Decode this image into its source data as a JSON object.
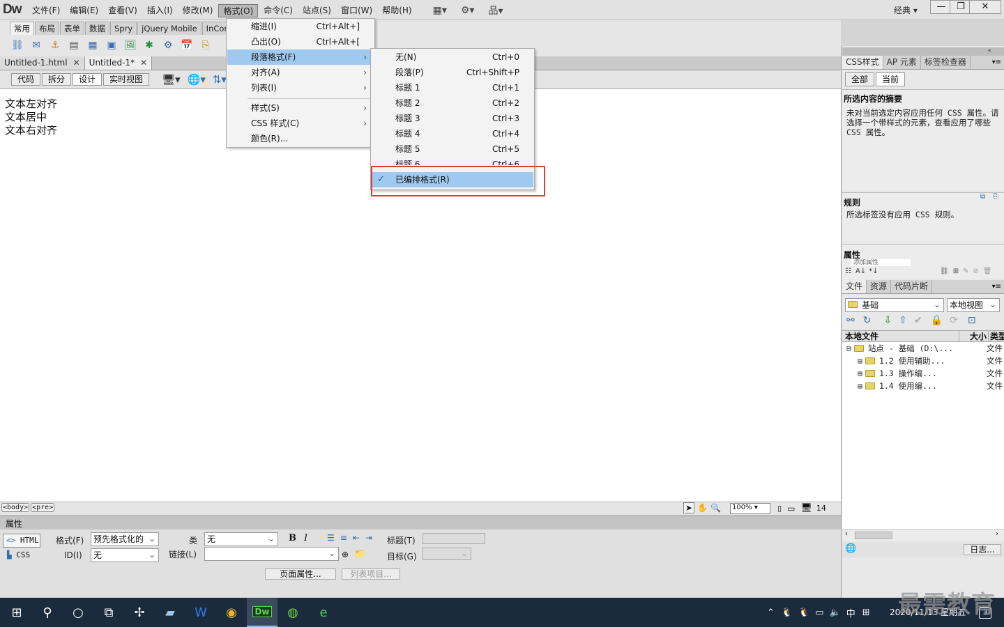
{
  "app": {
    "logo": "Dw",
    "layout": "经典"
  },
  "menubar": [
    "文件(F)",
    "编辑(E)",
    "查看(V)",
    "插入(I)",
    "修改(M)",
    "格式(O)",
    "命令(C)",
    "站点(S)",
    "窗口(W)",
    "帮助(H)"
  ],
  "insert_tabs": [
    "常用",
    "布局",
    "表单",
    "数据",
    "Spry",
    "jQuery Mobile",
    "InCont"
  ],
  "doc_tabs": [
    {
      "name": "Untitled-1.html"
    },
    {
      "name": "Untitled-1*"
    }
  ],
  "view_buttons": [
    "代码",
    "拆分",
    "设计",
    "实时视图"
  ],
  "document_lines": [
    "文本左对齐",
    "文本居中",
    "文本右对齐"
  ],
  "format_menu": [
    {
      "label": "缩进(I)",
      "shortcut": "Ctrl+Alt+]"
    },
    {
      "label": "凸出(O)",
      "shortcut": "Ctrl+Alt+["
    },
    {
      "label": "段落格式(F)",
      "arrow": "›"
    },
    {
      "label": "对齐(A)",
      "arrow": "›"
    },
    {
      "label": "列表(I)",
      "arrow": "›"
    },
    {
      "label": "样式(S)",
      "arrow": "›"
    },
    {
      "label": "CSS 样式(C)",
      "arrow": "›"
    },
    {
      "label": "颜色(R)..."
    }
  ],
  "paragraph_submenu": [
    {
      "label": "无(N)",
      "shortcut": "Ctrl+0"
    },
    {
      "label": "段落(P)",
      "shortcut": "Ctrl+Shift+P"
    },
    {
      "label": "标题 1",
      "shortcut": "Ctrl+1"
    },
    {
      "label": "标题 2",
      "shortcut": "Ctrl+2"
    },
    {
      "label": "标题 3",
      "shortcut": "Ctrl+3"
    },
    {
      "label": "标题 4",
      "shortcut": "Ctrl+4"
    },
    {
      "label": "标题 5",
      "shortcut": "Ctrl+5"
    },
    {
      "label": "标题 6",
      "shortcut": "Ctrl+6"
    },
    {
      "label": "已编排格式(R)",
      "checked": "✓"
    }
  ],
  "status": {
    "tags": [
      "<body>",
      "<pre>"
    ],
    "zoom": "100%",
    "size": "14"
  },
  "properties": {
    "title": "属性",
    "html_btn": "HTML",
    "css_btn": "CSS",
    "format_label": "格式(F)",
    "format_value": "预先格式化的",
    "id_label": "ID(I)",
    "id_value": "无",
    "class_label": "类",
    "class_value": "无",
    "link_label": "链接(L)",
    "heading_label": "标题(T)",
    "target_label": "目标(G)",
    "bold": "B",
    "italic": "I",
    "page_props": "页面属性...",
    "list_item": "列表项目..."
  },
  "css_panel": {
    "tabs": [
      "CSS样式",
      "AP 元素",
      "标签检查器"
    ],
    "modes": [
      "全部",
      "当前"
    ],
    "summary_title": "所选内容的摘要",
    "summary_text": "未对当前选定内容应用任何 CSS 属性。请选择一个带样式的元素，查看应用了哪些 CSS 属性。",
    "rules_title": "规则",
    "rules_text": "所选标签没有应用 CSS 规则。",
    "attrs_title": "属性",
    "add_attr": "添加属性"
  },
  "files_panel": {
    "tabs": [
      "文件",
      "资源",
      "代码片断"
    ],
    "site": "基础",
    "view": "本地视图",
    "col_name": "本地文件",
    "col_size": "大小",
    "col_type": "类型",
    "root": {
      "name": "站点 - 基础 (D:\\...",
      "type": "文件"
    },
    "items": [
      {
        "name": "1.2 使用辅助...",
        "type": "文件"
      },
      {
        "name": "1.3 操作编...",
        "type": "文件"
      },
      {
        "name": "1.4 使用编...",
        "type": "文件"
      }
    ],
    "log_btn": "日志..."
  },
  "taskbar": {
    "clock_date": "2020/11/13 星期五",
    "ime": "中",
    "badge": "3"
  },
  "watermark": "最需教育"
}
